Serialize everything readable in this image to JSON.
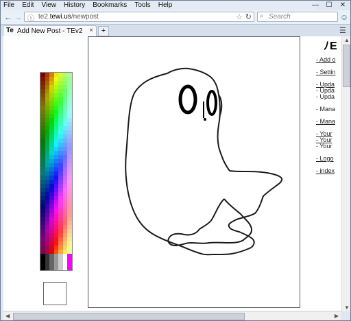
{
  "menu": [
    "File",
    "Edit",
    "View",
    "History",
    "Bookmarks",
    "Tools",
    "Help"
  ],
  "window_controls": {
    "minimize": "—",
    "maximize": "☐",
    "close": "✕"
  },
  "url": {
    "prefix": "te2.",
    "domain": "tewi.us",
    "path": "/newpost"
  },
  "search": {
    "placeholder": "Search"
  },
  "tab": {
    "favicon": "Te",
    "title": "Add New Post - TEv2",
    "close": "×"
  },
  "new_tab": "+",
  "right_panel": {
    "title": "ﾉE",
    "items": [
      {
        "text": "- Add o",
        "link": true
      },
      {
        "text": "",
        "link": false
      },
      {
        "text": "- Settin",
        "link": true
      },
      {
        "text": "",
        "link": false
      },
      {
        "text": "- Upda",
        "link": true
      },
      {
        "text": "- Upda",
        "link": false
      },
      {
        "text": "- Upda",
        "link": false
      },
      {
        "text": "",
        "link": false
      },
      {
        "text": "- Mana",
        "link": false
      },
      {
        "text": "",
        "link": false
      },
      {
        "text": "- Mana",
        "link": true
      },
      {
        "text": "",
        "link": false
      },
      {
        "text": "- Your",
        "link": true
      },
      {
        "text": "- Your",
        "link": true
      },
      {
        "text": "- Your",
        "link": false
      },
      {
        "text": "",
        "link": false
      },
      {
        "text": "- Logo",
        "link": true
      },
      {
        "text": "",
        "link": false
      },
      {
        "text": "- index",
        "link": true
      }
    ]
  },
  "colors": {
    "accent": "#3a5a80",
    "chrome": "#dfe7f1"
  },
  "icons": [
    "back-icon",
    "forward-icon",
    "info-icon",
    "bookmark-star-icon",
    "reload-icon",
    "search-icon",
    "smiley-icon",
    "tab-favicon",
    "new-tab-icon"
  ]
}
